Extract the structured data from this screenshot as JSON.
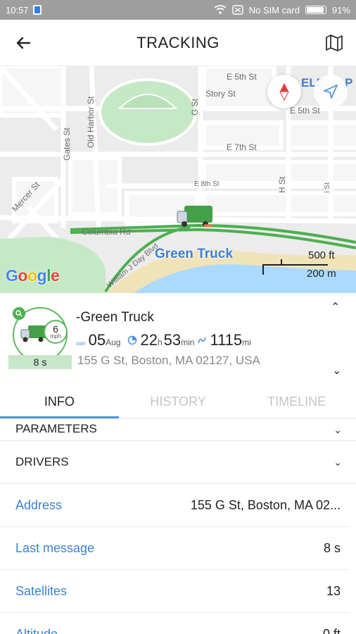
{
  "status_bar": {
    "time": "10:57",
    "network": "No SIM card",
    "battery": "91%",
    "battery_level": 0.91
  },
  "header": {
    "title": "TRACKING",
    "back_icon": "arrow-left-icon",
    "map_icon": "map-icon"
  },
  "map": {
    "streets": {
      "e5th": "E 5th St",
      "story": "Story St",
      "e5th_b": "E 5th St",
      "e7th": "E 7th St",
      "e8th": "E 8th St",
      "gst": "G St",
      "hst": "H St",
      "ist": "I St",
      "gates": "Gates St",
      "oldharbor": "Old Harbor St",
      "mercer": "Mercer St",
      "columbia": "Columbia Rd",
      "william": "William J Day Blvd",
      "partial_elf": "ELF",
      "partial_p": "P"
    },
    "unit_label": "Green Truck",
    "logo": "Google",
    "scale_ft": "500 ft",
    "scale_m": "200 m",
    "colors": {
      "route": "#4caf50",
      "water": "#aadaff",
      "park": "#c5e8c5",
      "beach": "#f1e3b8"
    }
  },
  "unit": {
    "name": "-Green Truck",
    "speed": "6",
    "speed_unit": "mph",
    "last_update": "8 s",
    "start_label": "start",
    "date_day": "05",
    "date_month": "Aug",
    "hours": "22",
    "hours_unit": "h",
    "minutes": "53",
    "minutes_unit": "min",
    "distance": "1115",
    "distance_unit": "mi",
    "address": "155 G St, Boston, MA 02127, USA"
  },
  "tabs": [
    "INFO",
    "HISTORY",
    "TIMELINE"
  ],
  "sections": {
    "parameters": "PARAMETERS",
    "drivers": "DRIVERS"
  },
  "rows": [
    {
      "label": "Address",
      "value": "155 G St, Boston, MA 02..."
    },
    {
      "label": "Last message",
      "value": "8 s"
    },
    {
      "label": "Satellites",
      "value": "13"
    },
    {
      "label": "Altitude",
      "value": "0 ft"
    }
  ]
}
